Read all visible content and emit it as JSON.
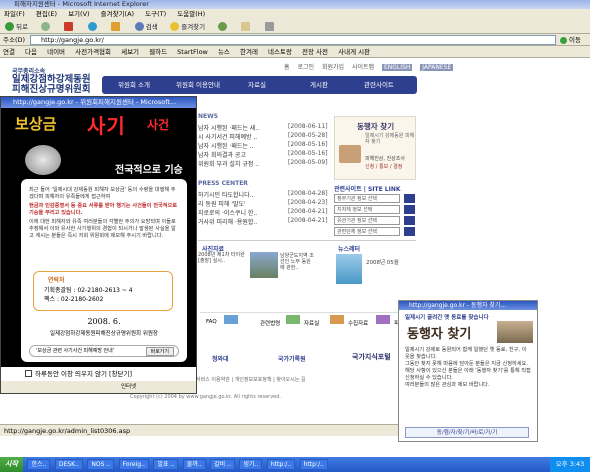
{
  "window": {
    "title": "피해자지원센터 - Microsoft Internet Explorer",
    "menu": [
      "파일(F)",
      "편집(E)",
      "보기(V)",
      "즐겨찾기(A)",
      "도구(T)",
      "도움말(H)"
    ],
    "toolbar": [
      "뒤로",
      "검색",
      "즐겨찾기"
    ],
    "address_label": "주소(D)",
    "address": "http://gangje.go.kr/",
    "go_label": "이동",
    "links": [
      "연결",
      "다음",
      "네이버",
      "사전가격협회",
      "세보기",
      "웹하드",
      "StartFlow",
      "뉴스",
      "한겨레",
      "네스토랑",
      "전장 사전",
      "사내게 시판"
    ]
  },
  "site": {
    "logo_small": "국무총리소속",
    "logo_line1": "일제강점하강제동원",
    "logo_line2": "피해진상규명위원회",
    "util_nav": [
      "홈",
      "로그인",
      "회원가입",
      "사이트맵",
      "ENGLISH",
      "JAPANESE"
    ],
    "nav": [
      "위원회 소개",
      "위원회 이용안내",
      "자료실",
      "게시판",
      "관련사이트"
    ],
    "news_head": "NEWS",
    "news": [
      {
        "title": "남자 시행된 ·패드는 새..",
        "date": "[2008-06-11]"
      },
      {
        "title": "시 사기서건 피해예방 ..",
        "date": "[2008-05-28]"
      },
      {
        "title": "남자 시행된 ·패드는 ..",
        "date": "[2008-05-16]"
      },
      {
        "title": "남자 회의결과 공고",
        "date": "[2008-05-16]"
      },
      {
        "title": "위원회 부과 설치 규정 ..",
        "date": "[2008-05-09]"
      }
    ],
    "press_head": "PRESS CENTER",
    "press": [
      {
        "title": "하기시민 타도합니다..",
        "date": "[2008-04-28]"
      },
      {
        "title": "리 동원 피해 '말도'",
        "date": "[2008-04-23]"
      },
      {
        "title": "지로로의 ·이스쿠니 한..",
        "date": "[2008-04-21]"
      },
      {
        "title": "거사위 피리해 ·용원합..",
        "date": "[2008-04-21]"
      }
    ],
    "search_head": "동행자 찾기",
    "search_sub": "일제시기 강제동원 피해자 찾기",
    "search_list": [
      "피해진상, 진상조사",
      "신청 / 통보 / 결정"
    ],
    "related_head": "관련사이트 | SITE LINK",
    "related_options": [
      "정부기관 정보 선택",
      "지자체 정보 선택",
      "유관기관 정보 선택",
      "관련단체 정보 선택"
    ],
    "photo_head": "사진자료",
    "photo_caption1": "남양군도지역 조선인 노무 동원에 관한..",
    "photo_caption2": "2008년 제1차 타이완 [출장] 실시..",
    "news_letter_head": "뉴스레터",
    "news_letter_caption": "2008년 05월",
    "quick": [
      "FAQ",
      "관련법령",
      "자료실",
      "수집자료",
      "피해자"
    ],
    "partners": [
      "청와대",
      "국가기록원",
      "국가지식포털"
    ],
    "footer_links": [
      "서비스 이용약관",
      "개인정보보호정책",
      "찾아오시는 길"
    ],
    "footer": "Copyright (c) 2004 by www.gangje.go.kr. All rights reserved."
  },
  "popup_left": {
    "title": "http://gangje.go.kr - 위원회피해지원센터 - Microsoft...",
    "head1": "보상금",
    "head2": "사기",
    "head3": "사건",
    "sub": "전국적으로 기승",
    "p1": "최근 들어 '일제시대 강제동원 피해자 보상금' 등의 수령을 대행해 주겠다며 피해자의 유족들에게 접근하여",
    "p2": "현금과 인감증명서 등 중요 서류를 받아 챙기는 사건들이 전국적으로 기승을 부리고 있습니다.",
    "p3": "이에 대한 피해자와 유족 여러분들의 각별한 주의가 요망되며 이들로 추정해서 이와 유사한 사기행위의 경험이 되시거나 발생된 사실을 알고 계시는 분들은 즉시 저희 위원회에 제보해 주시기 바랍니다.",
    "contact_head": "연락처",
    "contact_rows": [
      {
        "label": "기획총괄팀",
        "value": ": 02-2180-2613 ~ 4"
      },
      {
        "label": "팩스",
        "value": ": 02-2180-2602"
      }
    ],
    "date": "2008. 6.",
    "org": "일제강점하강제동원피해진상규명위원회 위원장",
    "banner": "'보상금 관련 사기사건 피해예방 안내'",
    "more_label": "바로가기",
    "checkbox_label": "하루동안 이창 띄우지 않기 [창닫기]",
    "status": "인터넷"
  },
  "popup_right": {
    "title": "http://gangje.go.kr - 동행자 찾기...",
    "head": "일제시기 끌려간 옛 동료를 찾습니다",
    "big": "동행자 찾기",
    "p1": "일제시기 강제로 동원되어 함께 일했던 옛 동료, 친구, 이웃을 찾습니다.",
    "p2": "그동안 찾지 못해 마음에 담아둔 분들은 지금 신청하세요.",
    "p3": "해당 사항이 있으신 분들은 아래 '동행자 찾기'를 통해 직접 신청하실 수 있습니다.",
    "p4": "여러분들의 많은 관심과 제보 바랍니다.",
    "link": "동/행/자/찾/기/바/로/가/기"
  },
  "status_bar": "http://gangje.go.kr/admin_list0306.asp",
  "taskbar": {
    "start": "시작",
    "tasks": [
      "한스..",
      "DESK..",
      "NOS ..",
      "Foreig..",
      "발표 ..",
      "몰까..",
      "갈비 ..",
      "빙기..",
      "http:/..",
      "http:/.."
    ],
    "clock": "오후 3:43"
  }
}
